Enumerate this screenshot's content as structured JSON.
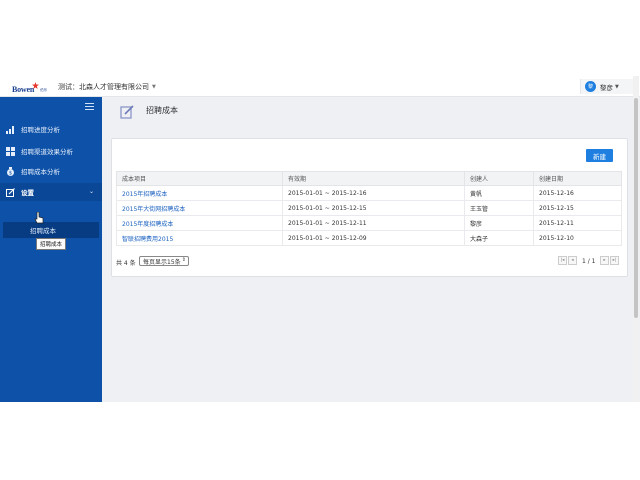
{
  "topbar": {
    "logo_text": "Bowen",
    "logo_cn": "伯乐",
    "company_label": "测试：北森人才管理有限公司",
    "user_avatar": "黎",
    "user_name": "黎彦"
  },
  "sidebar": {
    "items": [
      {
        "label": "招聘进度分析",
        "icon": "bar-chart-icon"
      },
      {
        "label": "招聘渠道效果分析",
        "icon": "grid-icon"
      },
      {
        "label": "招聘成本分析",
        "icon": "money-bag-icon"
      },
      {
        "label": "设置",
        "icon": "edit-icon"
      }
    ],
    "sub_item": "招聘成本",
    "tooltip": "招聘成本"
  },
  "header": {
    "title": "招聘成本"
  },
  "card": {
    "new_button": "新建",
    "columns": [
      "成本项目",
      "有效期",
      "创建人",
      "创建日期"
    ],
    "rows": [
      {
        "item": "2015年招聘成本",
        "period": "2015-01-01 ~ 2015-12-16",
        "creator": "黄帆",
        "date": "2015-12-16"
      },
      {
        "item": "2015年大街网招聘成本",
        "period": "2015-01-01 ~ 2015-12-15",
        "creator": "王玉管",
        "date": "2015-12-15"
      },
      {
        "item": "2015年度招聘成本",
        "period": "2015-01-01 ~ 2015-12-11",
        "creator": "黎彦",
        "date": "2015-12-11"
      },
      {
        "item": "智联招聘费用2015",
        "period": "2015-01-01 ~ 2015-12-09",
        "creator": "大森子",
        "date": "2015-12-10"
      }
    ],
    "total": "共 4 条",
    "page_size": "每页显示15条",
    "page": "1 / 1"
  },
  "colors": {
    "sidebar": "#0d52a8",
    "accent": "#1e7fe0",
    "link": "#1d63c1"
  }
}
